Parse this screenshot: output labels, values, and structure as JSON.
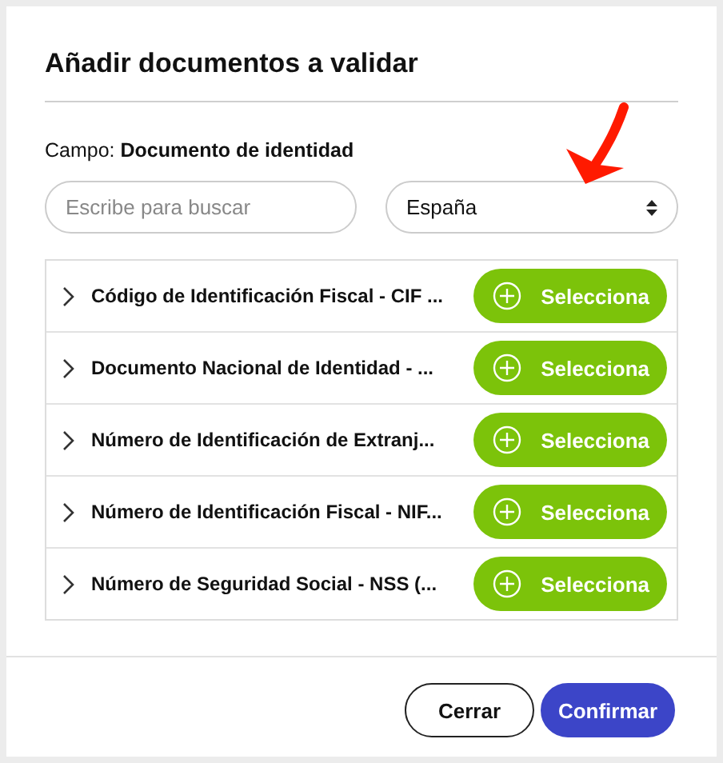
{
  "dialog": {
    "title": "Añadir documentos a validar",
    "field_label": "Campo: **Documento de identidad**",
    "search": {
      "placeholder": "Escribe para buscar"
    },
    "country_select": {
      "value": "España"
    },
    "documents": [
      {
        "name": "Código de Identificación Fiscal - CIF ...",
        "expanded": false,
        "action": "Selecciona"
      },
      {
        "name": "Documento Nacional de Identidad - ...",
        "expanded": false,
        "action": "Selecciona"
      },
      {
        "name": "Número de Identificación de Extranj...",
        "expanded": false,
        "action": "Selecciona"
      },
      {
        "name": "Número de Identificación Fiscal - NIF...",
        "expanded": false,
        "action": "Selecciona"
      },
      {
        "name": "Número de Seguridad Social - NSS (...",
        "expanded": false,
        "action": "Selecciona"
      }
    ],
    "buttons": [
      {
        "label": "Cerrar",
        "kind": "secondary"
      },
      {
        "label": "Confirmar",
        "kind": "primary"
      }
    ]
  }
}
